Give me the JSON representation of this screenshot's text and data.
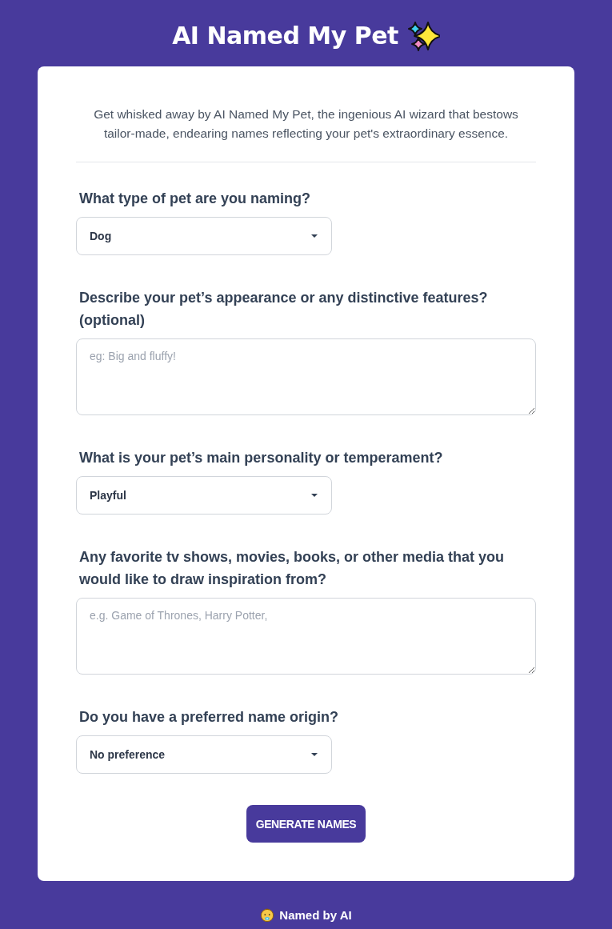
{
  "header": {
    "title": "AI Named My Pet"
  },
  "intro": "Get whisked away by AI Named My Pet, the ingenious AI wizard that bestows tailor-made, endearing names reflecting your pet's extraordinary essence.",
  "fields": [
    {
      "kind": "dropdown",
      "label": "What type of pet are you naming?",
      "value": "Dog"
    },
    {
      "kind": "textarea",
      "label": "Describe your pet’s appearance or any distinctive features? (optional)",
      "placeholder": "eg: Big and fluffy!"
    },
    {
      "kind": "dropdown",
      "label": "What is your pet’s main personality or temperament?",
      "value": "Playful"
    },
    {
      "kind": "textarea",
      "label": "Any favorite tv shows, movies, books, or other media that you would like to draw inspiration from?",
      "placeholder": "e.g. Game of Thrones, Harry Potter,"
    },
    {
      "kind": "dropdown",
      "label": "Do you have a preferred name origin?",
      "value": "No preference"
    }
  ],
  "submit_button": "GENERATE NAMES",
  "footer": {
    "text": "Named by AI"
  }
}
